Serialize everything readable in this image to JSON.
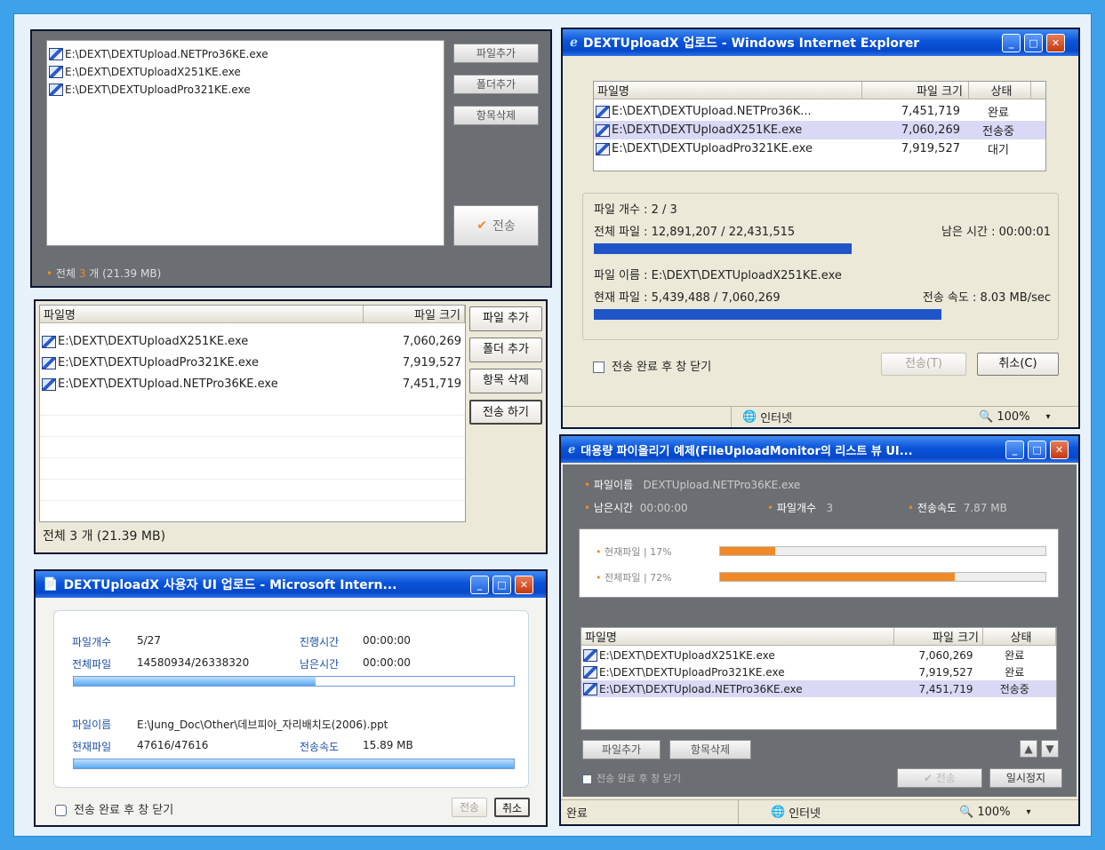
{
  "p1": {
    "files": [
      "E:\\DEXT\\DEXTUpload.NETPro36KE.exe",
      "E:\\DEXT\\DEXTUploadX251KE.exe",
      "E:\\DEXT\\DEXTUploadPro321KE.exe"
    ],
    "add_file": "파일추가",
    "add_folder": "폴더추가",
    "delete_item": "항목삭제",
    "send": "전송",
    "summary_prefix": "전체",
    "summary_count": "3",
    "summary_suffix": "개 (21.39 MB)"
  },
  "p2": {
    "col_name": "파일명",
    "col_size": "파일 크기",
    "rows": [
      {
        "name": "E:\\DEXT\\DEXTUploadX251KE.exe",
        "size": "7,060,269"
      },
      {
        "name": "E:\\DEXT\\DEXTUploadPro321KE.exe",
        "size": "7,919,527"
      },
      {
        "name": "E:\\DEXT\\DEXTUpload.NETPro36KE.exe",
        "size": "7,451,719"
      }
    ],
    "add_file": "파일 추가",
    "add_folder": "폴더 추가",
    "delete_item": "항목 삭제",
    "send": "전송 하기",
    "summary": "전체 3 개 (21.39 MB)"
  },
  "p3": {
    "title": "DEXTUploadX 사용자 UI 업로드 - Microsoft Intern...",
    "file_count_label": "파일개수",
    "file_count": "5/27",
    "elapsed_label": "진행시간",
    "elapsed": "00:00:00",
    "total_label": "전체파일",
    "total": "14580934/26338320",
    "remaining_label": "남은시간",
    "remaining": "00:00:00",
    "total_progress": 0.55,
    "filename_label": "파일이름",
    "filename": "E:\\Jung_Doc\\Other\\데브피아_자리배치도(2006).ppt",
    "current_label": "현재파일",
    "current": "47616/47616",
    "speed_label": "전송속도",
    "speed": "15.89 MB",
    "current_progress": 1.0,
    "close_after": "전송 완료 후 창 닫기",
    "send": "전송",
    "cancel": "취소"
  },
  "p4": {
    "title": "DEXTUploadX 업로드 - Windows Internet Explorer",
    "col_name": "파일명",
    "col_size": "파일 크기",
    "col_status": "상태",
    "rows": [
      {
        "name": "E:\\DEXT\\DEXTUpload.NETPro36K...",
        "size": "7,451,719",
        "status": "완료"
      },
      {
        "name": "E:\\DEXT\\DEXTUploadX251KE.exe",
        "size": "7,060,269",
        "status": "전송중"
      },
      {
        "name": "E:\\DEXT\\DEXTUploadPro321KE.exe",
        "size": "7,919,527",
        "status": "대기"
      }
    ],
    "file_count": "파일 개수 : 2 / 3",
    "total_files": "전체 파일 : 12,891,207 / 22,431,515",
    "remaining": "남은 시간 : 00:00:01",
    "total_progress": 0.57,
    "filename": "파일 이름 : E:\\DEXT\\DEXTUploadX251KE.exe",
    "current": "현재 파일 : 5,439,488 / 7,060,269",
    "speed": "전송 속도 : 8.03 MB/sec",
    "current_progress": 0.77,
    "close_after": "전송 완료 후 창 닫기",
    "send": "전송(T)",
    "cancel": "취소(C)",
    "zone": "인터넷",
    "zoom": "100%"
  },
  "p5": {
    "title": "대용량 파이올리기 예제(FileUploadMonitor의 리스트 뷰 UI...",
    "filename_label": "파일이름",
    "filename": "DEXTUpload.NETPro36KE.exe",
    "remaining_label": "남은시간",
    "remaining": "00:00:00",
    "count_label": "파일개수",
    "count": "3",
    "speed_label": "전송속도",
    "speed": "7.87 MB",
    "current_label": "현재파일 | 17%",
    "current_progress": 0.17,
    "total_label": "전체파일 | 72%",
    "total_progress": 0.72,
    "col_name": "파일명",
    "col_size": "파일 크기",
    "col_status": "상태",
    "rows": [
      {
        "name": "E:\\DEXT\\DEXTUploadX251KE.exe",
        "size": "7,060,269",
        "status": "완료"
      },
      {
        "name": "E:\\DEXT\\DEXTUploadPro321KE.exe",
        "size": "7,919,527",
        "status": "완료"
      },
      {
        "name": "E:\\DEXT\\DEXTUpload.NETPro36KE.exe",
        "size": "7,451,719",
        "status": "전송중"
      }
    ],
    "add_file": "파일추가",
    "delete_item": "항목삭제",
    "close_after": "전송 완료 후 창 닫기",
    "send": "전송",
    "pause": "일시정지",
    "done": "완료",
    "zone": "인터넷",
    "zoom": "100%"
  },
  "colors": {
    "accent": "#0a53d9",
    "orange": "#f08a24",
    "progress_blue": "#1f55c8"
  }
}
